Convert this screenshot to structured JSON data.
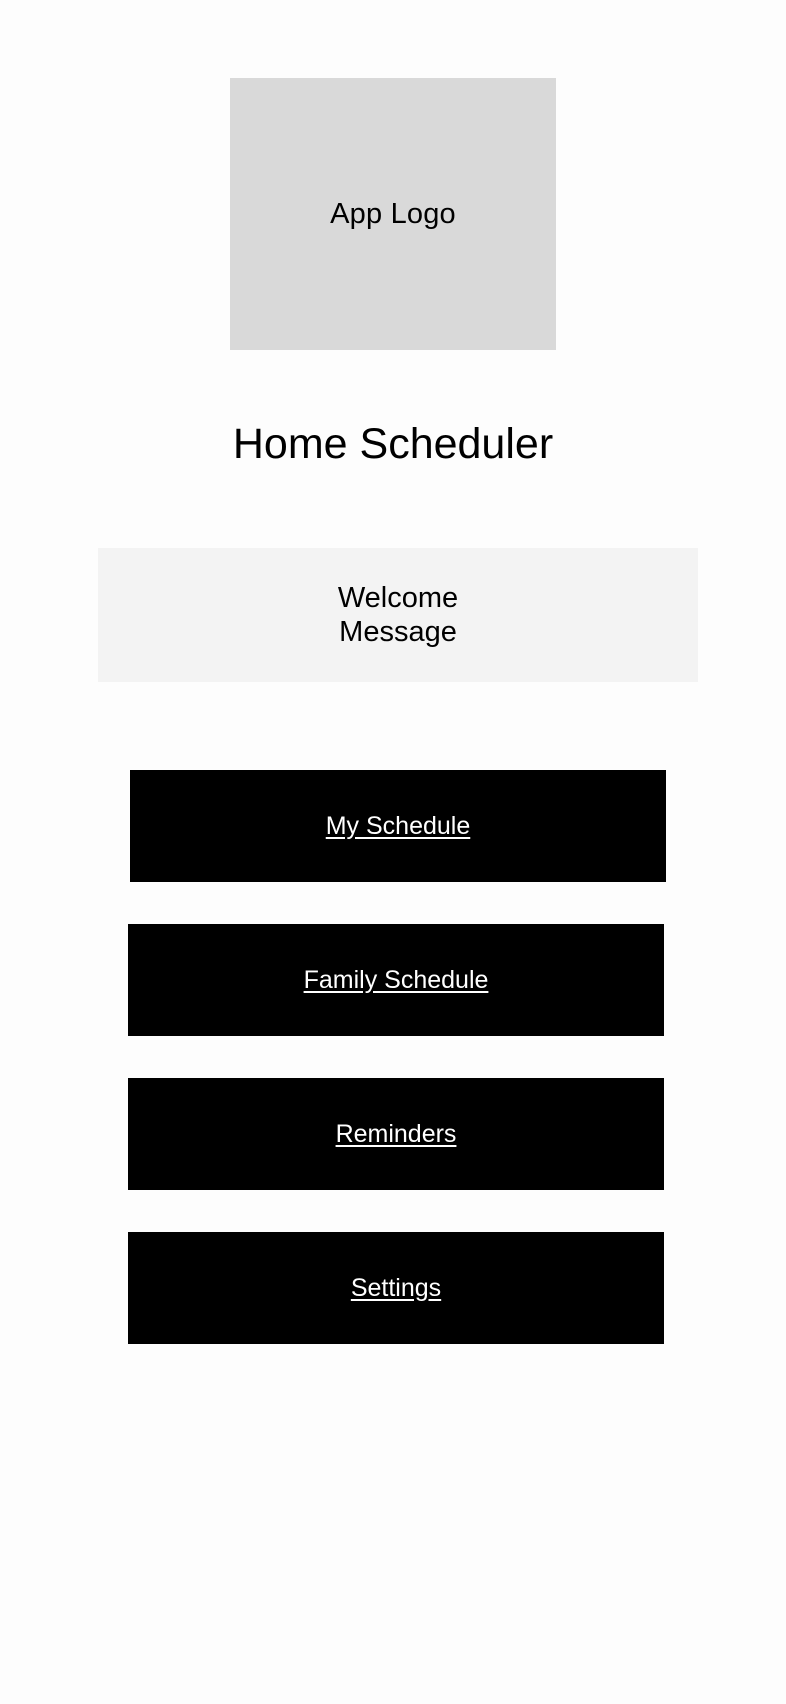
{
  "logo": {
    "label": "App Logo"
  },
  "header": {
    "title": "Home Scheduler"
  },
  "welcome": {
    "message": "Welcome Message"
  },
  "nav": {
    "my_schedule": "My Schedule",
    "family_schedule": "Family Schedule",
    "reminders": "Reminders",
    "settings": "Settings"
  },
  "colors": {
    "button_background": "#000000",
    "button_text": "#ffffff",
    "logo_placeholder": "#d9d9d9",
    "welcome_background": "#f3f3f3",
    "page_background": "#fdfdfd"
  }
}
